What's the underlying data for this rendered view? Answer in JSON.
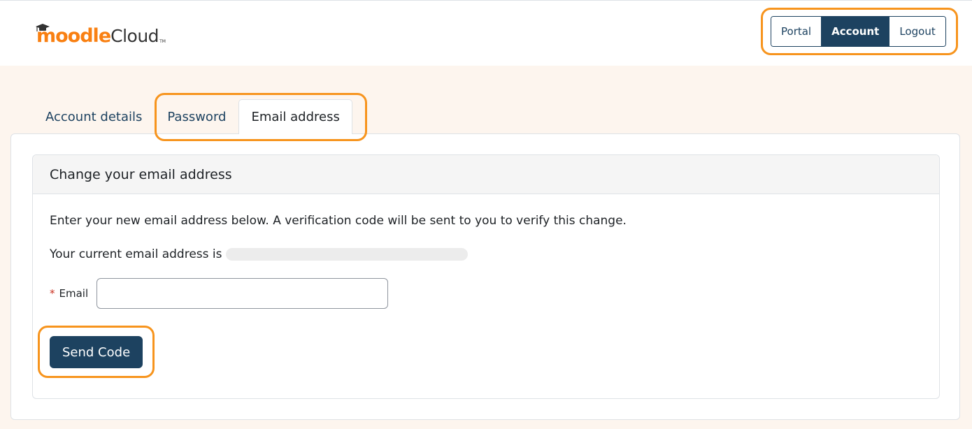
{
  "header": {
    "logo": {
      "moodle": "moodle",
      "cloud": "Cloud",
      "tm": "TM",
      "icon": "graduation-cap-icon"
    },
    "nav": [
      {
        "label": "Portal",
        "active": false
      },
      {
        "label": "Account",
        "active": true
      },
      {
        "label": "Logout",
        "active": false
      }
    ]
  },
  "tabs": [
    {
      "label": "Account details",
      "active": false
    },
    {
      "label": "Password",
      "active": false
    },
    {
      "label": "Email address",
      "active": true
    }
  ],
  "card": {
    "title": "Change your email address",
    "intro": "Enter your new email address below. A verification code will be sent to you to verify this change.",
    "current_prefix": "Your current email address is",
    "email_field": {
      "required_marker": "*",
      "label": "Email",
      "value": "",
      "placeholder": ""
    },
    "send_button": "Send Code"
  },
  "colors": {
    "accent": "#1d4260",
    "brand_orange": "#f98012",
    "highlight": "#f7941d",
    "page_bg": "#fdf5ee"
  }
}
